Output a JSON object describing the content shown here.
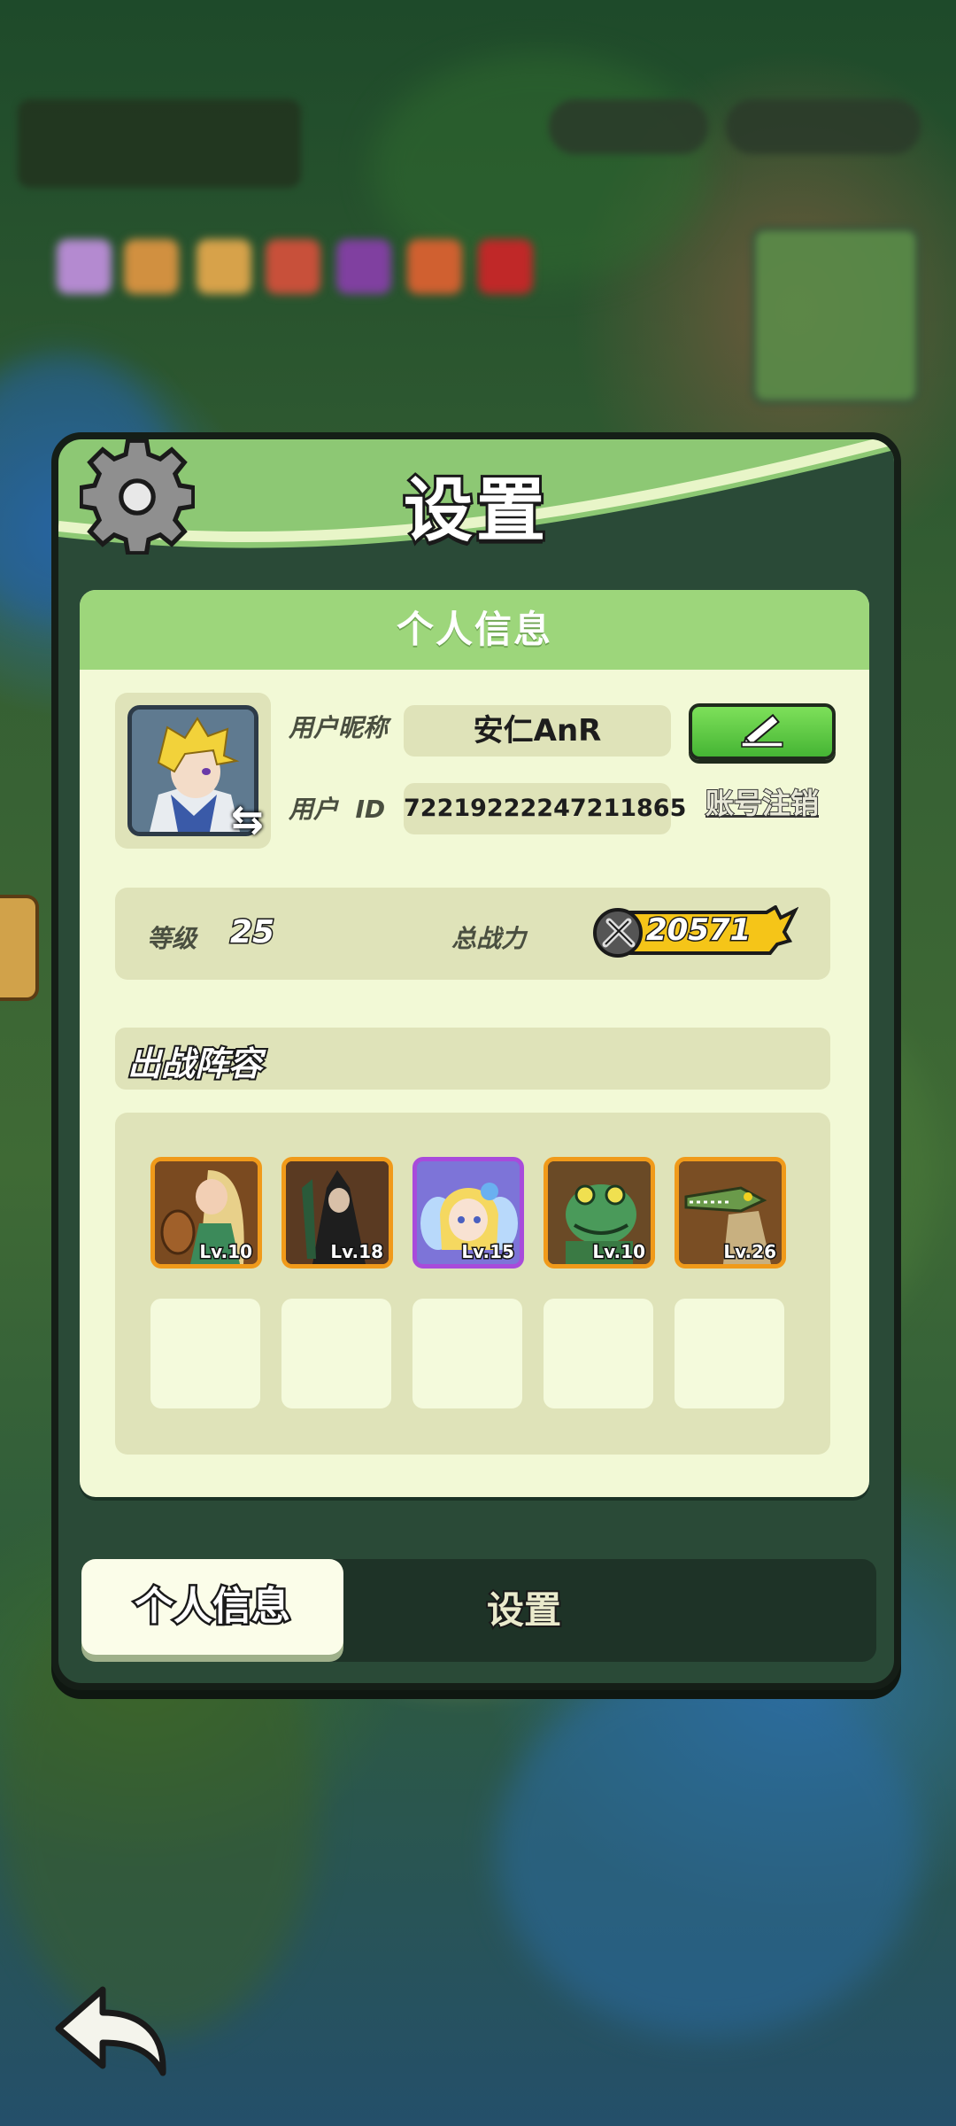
{
  "window": {
    "title": "设置"
  },
  "card": {
    "header": "个人信息"
  },
  "profile": {
    "nickname_label": "用户昵称",
    "nickname_value": "安仁AnR",
    "id_label": "用户  ID",
    "id_value": "72219222247211865",
    "account_cancel": "账号注销"
  },
  "stats": {
    "level_label": "等级",
    "level_value": "25",
    "power_label": "总战力",
    "power_value": "20571"
  },
  "lineup": {
    "title": "出战阵容",
    "heroes": [
      {
        "level": "Lv.10",
        "icon": "lute-bard-hero",
        "frame": "#f09a1a"
      },
      {
        "level": "Lv.18",
        "icon": "dark-mage-hero",
        "frame": "#f09a1a"
      },
      {
        "level": "Lv.15",
        "icon": "fairy-hero",
        "frame": "#a84bdb"
      },
      {
        "level": "Lv.10",
        "icon": "frog-hero",
        "frame": "#f09a1a"
      },
      {
        "level": "Lv.26",
        "icon": "crocodile-hero",
        "frame": "#f09a1a"
      }
    ],
    "empty_slots": 5
  },
  "tabs": [
    {
      "label": "个人信息",
      "active": true
    },
    {
      "label": "设置",
      "active": false
    }
  ],
  "colors": {
    "header_green": "#8dc874",
    "card_bg": "#f2f9d6",
    "edit_button": "#45b534",
    "power_badge": "#f5c518"
  }
}
